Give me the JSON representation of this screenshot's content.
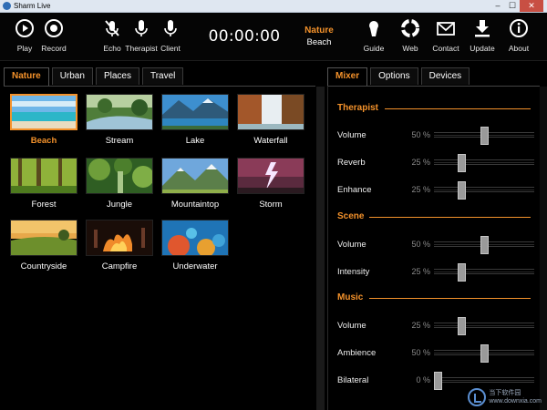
{
  "window": {
    "title": "Sharm Live",
    "buttons": [
      "–",
      "☐",
      "✕"
    ]
  },
  "toolbar": {
    "play": "Play",
    "record": "Record",
    "echo": "Echo",
    "therapist": "Therapist",
    "client": "Client",
    "timer": "00:00:00",
    "now_category": "Nature",
    "now_item": "Beach",
    "guide": "Guide",
    "web": "Web",
    "contact": "Contact",
    "update": "Update",
    "about": "About"
  },
  "left_tabs": [
    "Nature",
    "Urban",
    "Places",
    "Travel"
  ],
  "active_left_tab": "Nature",
  "scenes": [
    {
      "name": "Beach",
      "selected": true
    },
    {
      "name": "Stream",
      "selected": false
    },
    {
      "name": "Lake",
      "selected": false
    },
    {
      "name": "Waterfall",
      "selected": false
    },
    {
      "name": "Forest",
      "selected": false
    },
    {
      "name": "Jungle",
      "selected": false
    },
    {
      "name": "Mountaintop",
      "selected": false
    },
    {
      "name": "Storm",
      "selected": false
    },
    {
      "name": "Countryside",
      "selected": false
    },
    {
      "name": "Campfire",
      "selected": false
    },
    {
      "name": "Underwater",
      "selected": false
    }
  ],
  "right_tabs": [
    "Mixer",
    "Options",
    "Devices"
  ],
  "active_right_tab": "Mixer",
  "mixer": {
    "therapist": {
      "title": "Therapist",
      "rows": [
        {
          "label": "Volume",
          "value": "50 %",
          "level": 0.5
        },
        {
          "label": "Reverb",
          "value": "25 %",
          "level": 0.25
        },
        {
          "label": "Enhance",
          "value": "25 %",
          "level": 0.25
        }
      ]
    },
    "scene": {
      "title": "Scene",
      "rows": [
        {
          "label": "Volume",
          "value": "50 %",
          "level": 0.5
        },
        {
          "label": "Intensity",
          "value": "25 %",
          "level": 0.25
        }
      ]
    },
    "music": {
      "title": "Music",
      "rows": [
        {
          "label": "Volume",
          "value": "25 %",
          "level": 0.25
        },
        {
          "label": "Ambience",
          "value": "50 %",
          "level": 0.5
        },
        {
          "label": "Bilateral",
          "value": "0 %",
          "level": 0.0
        }
      ]
    }
  },
  "watermark": {
    "line1": "当下软件园",
    "line2": "www.downxia.com"
  },
  "colors": {
    "accent": "#f4922b",
    "background": "#000000"
  }
}
